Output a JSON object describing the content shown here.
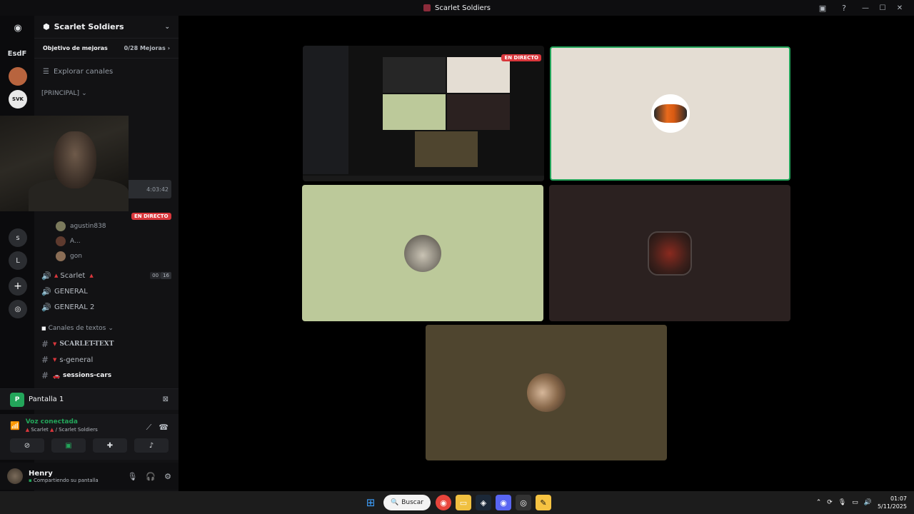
{
  "window": {
    "title": "Scarlet Soldiers"
  },
  "rail": {
    "home_icon": "discord-logo-icon",
    "items": [
      "EsdF",
      "s",
      "L"
    ]
  },
  "server": {
    "name": "Scarlet Soldiers",
    "boost_label": "Objetivo de mejoras",
    "boost_progress": "0/28 Mejoras",
    "explore": "Explorar canales",
    "category_main": "[PRINCIPAL]",
    "stream_timer": "4:03:42",
    "live_label": "EN DIRECTO",
    "voice_users": [
      "agustin838",
      "A...",
      "gon"
    ],
    "voice_channels": [
      {
        "label": "Scarlet",
        "count_a": "00",
        "count_b": "16"
      },
      {
        "label": "GENERAL"
      },
      {
        "label": "GENERAL 2"
      }
    ],
    "text_category": "Canales de textos",
    "text_channels": [
      "SCARLET-TEXT",
      "s-general",
      "sessions-cars"
    ]
  },
  "stream_panel": {
    "title": "Pantalla 1",
    "voice_status": "Voz conectada",
    "voice_sub_channel": "Scarlet",
    "voice_sub_server": "/ Scarlet Soldiers"
  },
  "user": {
    "name": "Henry",
    "status": "Compartiendo su pantalla"
  },
  "stage": {
    "live_badge": "EN DIRECTO",
    "colors": {
      "tile_beige": "#e4ddd3",
      "tile_green": "#bcc99a",
      "tile_dark": "#2b2120",
      "tile_brown": "#4f452f",
      "speaking_border": "#23a55a"
    }
  },
  "taskbar": {
    "search": "Buscar",
    "time": "01:07",
    "date": "5/11/2025"
  }
}
